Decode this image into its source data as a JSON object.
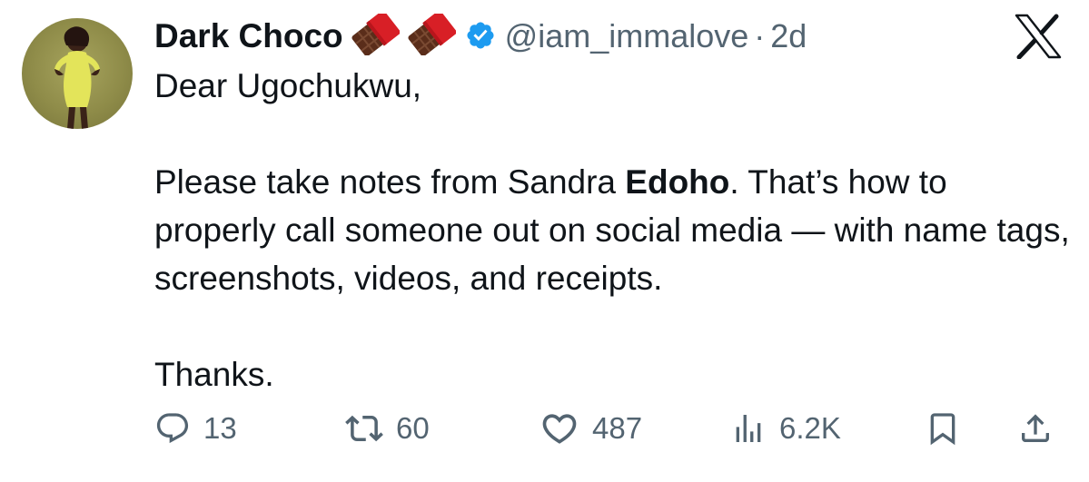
{
  "post": {
    "author_name": "Dark Choco",
    "name_emoji": [
      "chocolate-bar-emoji",
      "chocolate-bar-emoji"
    ],
    "verified": true,
    "handle": "@iam_immalove",
    "separator": "·",
    "time": "2d",
    "greeting": "Dear Ugochukwu,",
    "para_before": "Please take notes from Sandra ",
    "para_bold": "Edoho",
    "para_after": ". That’s how to properly call someone out on social media — with name tags, screenshots, videos, and receipts.",
    "closing": "Thanks."
  },
  "brand": {
    "logo": "x-logo-icon"
  },
  "actions": {
    "replies": "13",
    "reposts": "60",
    "likes": "487",
    "views": "6.2K"
  },
  "colors": {
    "text": "#0f1419",
    "secondary": "#536471",
    "verified": "#1d9bf0",
    "chocolate": "#5a2d1a",
    "wrapper": "#d81f26"
  }
}
